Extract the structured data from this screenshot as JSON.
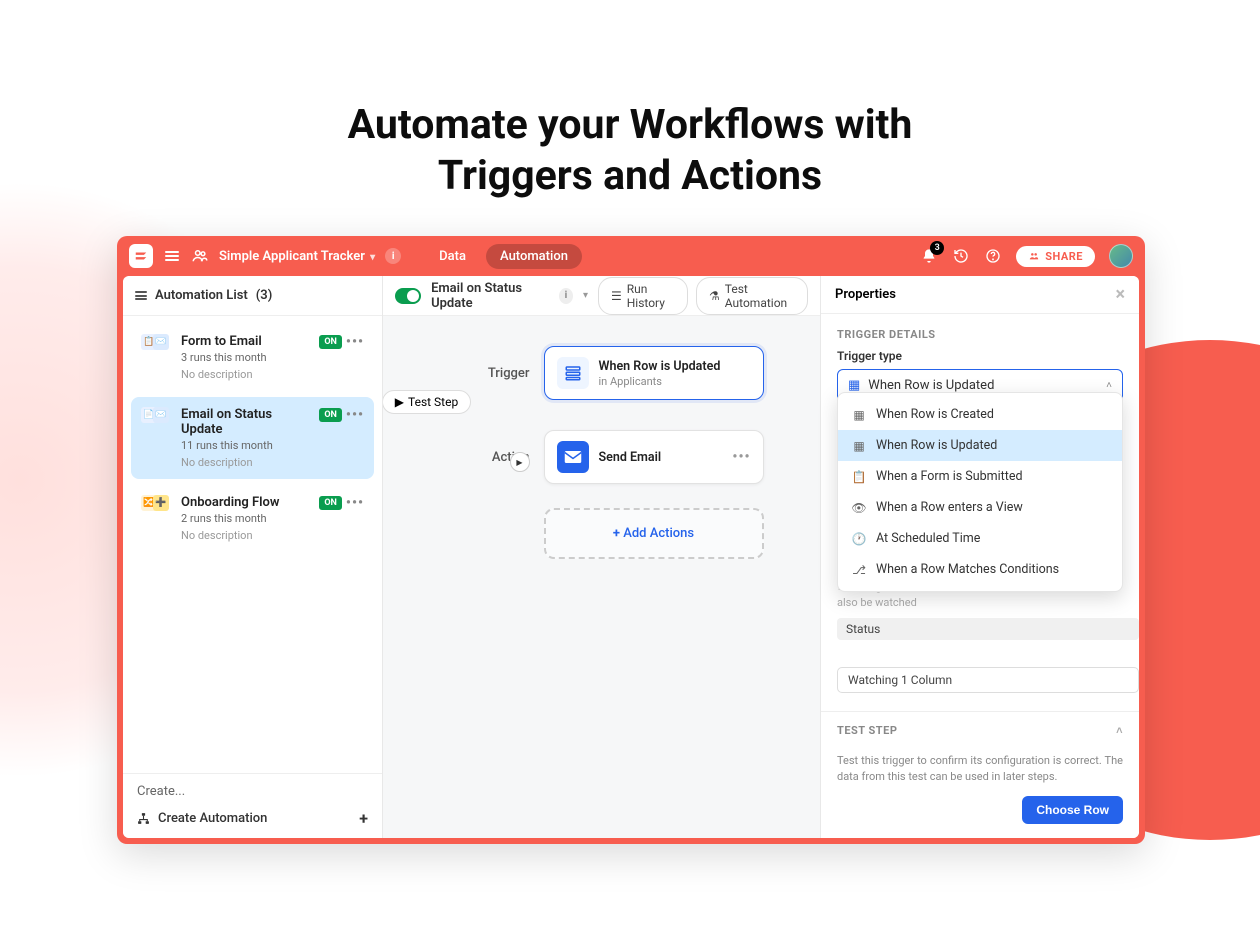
{
  "hero": {
    "line1": "Automate your Workflows with",
    "line2": "Triggers and Actions"
  },
  "topbar": {
    "app_title": "Simple Applicant Tracker",
    "tabs": {
      "data": "Data",
      "automation": "Automation"
    },
    "notifications_count": "3",
    "share_label": "SHARE"
  },
  "sidebar": {
    "header": "Automation List",
    "count": "(3)",
    "items": [
      {
        "title": "Form to Email",
        "sub": "3 runs this month",
        "desc": "No description",
        "status": "ON"
      },
      {
        "title": "Email on Status Update",
        "sub": "11 runs this month",
        "desc": "No description",
        "status": "ON"
      },
      {
        "title": "Onboarding Flow",
        "sub": "2 runs this month",
        "desc": "No description",
        "status": "ON"
      }
    ],
    "footer": {
      "create": "Create...",
      "create_automation": "Create Automation"
    }
  },
  "canvas": {
    "title": "Email on Status Update",
    "run_history": "Run History",
    "test_automation": "Test Automation",
    "labels": {
      "trigger": "Trigger",
      "action": "Action",
      "test_step": "Test Step"
    },
    "trigger_step": {
      "title": "When Row is Updated",
      "sub": "in Applicants"
    },
    "action_step": {
      "title": "Send Email"
    },
    "add_actions": "Add Actions"
  },
  "props": {
    "header": "Properties",
    "section1_title": "TRIGGER DETAILS",
    "trigger_type_label": "Trigger type",
    "selected_trigger": "When Row is Updated",
    "dropdown": [
      "When Row is Created",
      "When Row is Updated",
      "When a Form is Submitted",
      "When a Row enters a View",
      "At Scheduled Time",
      "When a Row Matches Conditions"
    ],
    "note": "watching all columns, columns created in the future will also be watched",
    "chip": "Status",
    "watching": "Watching 1 Column",
    "section2_title": "TEST STEP",
    "section2_text": "Test this trigger to confirm its configuration is correct. The data from this test can be used in later steps.",
    "choose_row": "Choose Row"
  }
}
